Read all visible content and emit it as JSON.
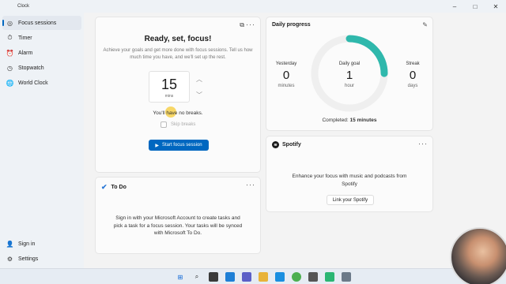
{
  "app": {
    "title": "Clock"
  },
  "window_controls": {
    "minimize": "–",
    "maximize": "□",
    "close": "✕"
  },
  "sidebar": {
    "items": [
      {
        "label": "Focus sessions",
        "icon": "focus-icon",
        "glyph": "◎",
        "active": true
      },
      {
        "label": "Timer",
        "icon": "timer-icon",
        "glyph": "⏱",
        "active": false
      },
      {
        "label": "Alarm",
        "icon": "alarm-icon",
        "glyph": "⏰",
        "active": false
      },
      {
        "label": "Stopwatch",
        "icon": "stopwatch-icon",
        "glyph": "◷",
        "active": false
      },
      {
        "label": "World Clock",
        "icon": "globe-icon",
        "glyph": "🌐",
        "active": false
      }
    ],
    "bottom": [
      {
        "label": "Sign in",
        "icon": "user-icon",
        "glyph": "👤"
      },
      {
        "label": "Settings",
        "icon": "gear-icon",
        "glyph": "⚙"
      }
    ]
  },
  "focus": {
    "title": "Ready, set, focus!",
    "description": "Achieve your goals and get more done with focus sessions. Tell us how much time you have, and we'll set up the rest.",
    "timer_value": "15",
    "timer_unit": "mins",
    "breaks_text": "You'll have no breaks.",
    "skip_label": "Skip breaks",
    "start_label": "Start focus session",
    "more": "···"
  },
  "todo": {
    "title": "To Do",
    "description": "Sign in with your Microsoft Account to create tasks and pick a task for a focus session. Your tasks will be synced with Microsoft To Do.",
    "more": "···"
  },
  "daily_progress": {
    "title": "Daily progress",
    "yesterday": {
      "label": "Yesterday",
      "value": "0",
      "unit": "minutes"
    },
    "goal": {
      "label": "Daily goal",
      "value": "1",
      "unit": "hour"
    },
    "streak": {
      "label": "Streak",
      "value": "0",
      "unit": "days"
    },
    "completed_prefix": "Completed:",
    "completed_value": "15 minutes",
    "goal_fraction": 0.25,
    "ring_color": "#2fb8ac"
  },
  "spotify": {
    "title": "Spotify",
    "description": "Enhance your focus with music and podcasts from Spotify",
    "link_label": "Link your Spotify",
    "more": "···"
  },
  "colors": {
    "accent": "#0067c0",
    "ring": "#2fb8ac"
  }
}
